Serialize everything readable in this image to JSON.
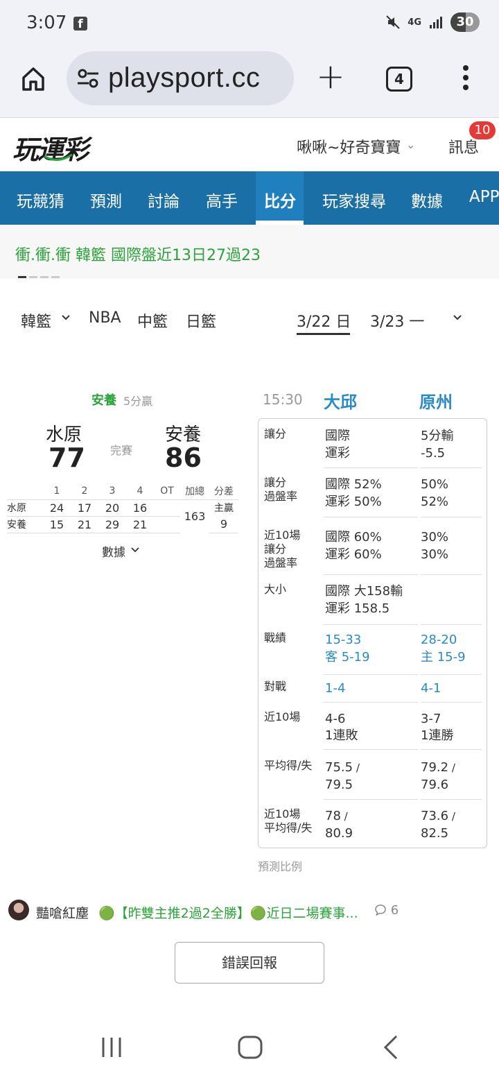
{
  "status_bar": {
    "time": "3:07",
    "battery": "30",
    "network": "4G"
  },
  "browser": {
    "url": "playsport.cc",
    "tab_count": "4"
  },
  "site": {
    "user_name": "啾啾~好奇寶寶",
    "messages_label": "訊息",
    "messages_badge": "10"
  },
  "nav": {
    "items": [
      "玩競猜",
      "預測",
      "討論",
      "高手",
      "比分",
      "玩家搜尋",
      "數據",
      "APP"
    ],
    "active": "比分"
  },
  "ticker": {
    "text": "衝.衝.衝 韓籃 國際盤近13日27過23"
  },
  "filters": {
    "leagues": [
      "韓籃",
      "NBA",
      "中籃",
      "日籃"
    ],
    "dates": [
      "3/22 日",
      "3/23 一"
    ]
  },
  "game": {
    "winner": "安養",
    "winner_margin": "5分贏",
    "status": "完賽",
    "away_team": "水原",
    "away_score": "77",
    "home_team": "安養",
    "home_score": "86",
    "quarter_headers": [
      "1",
      "2",
      "3",
      "4",
      "OT",
      "加總",
      "分差"
    ],
    "rows": [
      {
        "team": "水原",
        "q": [
          "24",
          "17",
          "20",
          "16",
          ""
        ]
      },
      {
        "team": "安養",
        "q": [
          "15",
          "21",
          "29",
          "21",
          ""
        ]
      }
    ],
    "total": "163",
    "diff_label": "主贏",
    "diff_value": "9",
    "data_link": "數據"
  },
  "stats": {
    "time": "15:30",
    "team1": "大邱",
    "team2": "原州",
    "spread": {
      "label": "讓分",
      "c1_l1": "國際",
      "c1_l2": "運彩",
      "c2_l1": "5分輸",
      "c2_l2": "-5.5"
    },
    "spread_rate": {
      "label_l1": "讓分",
      "label_l2": "過盤率",
      "c1_l1": "國際 52%",
      "c1_l2": "運彩 50%",
      "c2_l1": "50%",
      "c2_l2": "52%"
    },
    "last10_spread": {
      "label_l1": "近10場",
      "label_l2": "讓分",
      "label_l3": "過盤率",
      "c1_l1": "國際 60%",
      "c1_l2": "運彩 60%",
      "c2_l1": "30%",
      "c2_l2": "30%"
    },
    "total": {
      "label": "大小",
      "c1_l1": "國際 大158輸",
      "c1_l2": "運彩 158.5"
    },
    "record": {
      "label": "戰績",
      "c1_l1": "15-33",
      "c1_l2": "客 5-19",
      "c2_l1": "28-20",
      "c2_l2": "主 15-9"
    },
    "h2h": {
      "label": "對戰",
      "c1": "1-4",
      "c2": "4-1"
    },
    "last10": {
      "label": "近10場",
      "c1_l1": "4-6",
      "c1_l2": "1連敗",
      "c2_l1": "3-7",
      "c2_l2": "1連勝"
    },
    "avg": {
      "label": "平均得/失",
      "c1_l1": "75.5",
      "c1_l2": "79.5",
      "c2_l1": "79.2",
      "c2_l2": "79.6"
    },
    "last10_avg": {
      "label_l1": "近10場",
      "label_l2": "平均得/失",
      "c1_l1": "78",
      "c1_l2": "80.9",
      "c2_l1": "73.6",
      "c2_l2": "82.5"
    }
  },
  "predict_label": "預測比例",
  "post": {
    "user": "豔嗆紅塵",
    "text": "🟢【昨雙主推2過2全勝】🟢近日二場賽事...",
    "comments": "6"
  },
  "report_button": "錯誤回報",
  "colors": {
    "nav_bg": "#1a6fa6",
    "accent_green": "#2ba33a",
    "team_blue": "#2a8ac8",
    "badge_red": "#e53935"
  }
}
